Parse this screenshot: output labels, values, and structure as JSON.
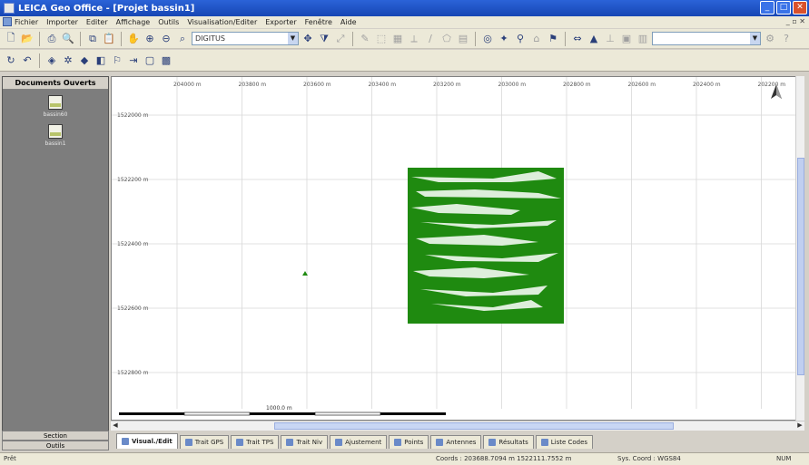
{
  "window": {
    "title": "LEICA Geo Office - [Projet bassin1]",
    "minimize_glyph": "_",
    "maximize_glyph": "□",
    "close_glyph": "✕"
  },
  "menu": {
    "items": [
      "Fichier",
      "Importer",
      "Editer",
      "Affichage",
      "Outils",
      "Visualisation/Editer",
      "Exporter",
      "Fenêtre",
      "Aide"
    ],
    "mdi_controls": "_ ▫ ✕"
  },
  "toolbar": {
    "coord_system_value": "DIGITUS"
  },
  "sidebar": {
    "header": "Documents Ouverts",
    "projects": [
      {
        "label": "bassin60"
      },
      {
        "label": "bassin1"
      }
    ],
    "bottom_buttons": [
      "Section",
      "Outils"
    ]
  },
  "map": {
    "x_ticks": [
      "204000 m",
      "203800 m",
      "203600 m",
      "203400 m",
      "203200 m",
      "203000 m",
      "202800 m",
      "202600 m",
      "202400 m",
      "202200 m"
    ],
    "y_ticks": [
      "1522000 m",
      "1522200 m",
      "1522400 m",
      "1522600 m",
      "1522800 m"
    ],
    "scale_label": "1000.0 m",
    "data_color": "#1f8a10",
    "north_arrow": "north-arrow-icon"
  },
  "tabs": [
    {
      "label": "Visual./Edit",
      "active": true
    },
    {
      "label": "Trait GPS",
      "active": false
    },
    {
      "label": "Trait TPS",
      "active": false
    },
    {
      "label": "Trait Niv",
      "active": false
    },
    {
      "label": "Ajustement",
      "active": false
    },
    {
      "label": "Points",
      "active": false
    },
    {
      "label": "Antennes",
      "active": false
    },
    {
      "label": "Résultats",
      "active": false
    },
    {
      "label": "Liste Codes",
      "active": false
    }
  ],
  "status": {
    "left": "Prêt",
    "coords": "Coords : 203688.7094 m 1522111.7552 m",
    "system": "Sys. Coord : WGS84",
    "mode": "NUM"
  }
}
